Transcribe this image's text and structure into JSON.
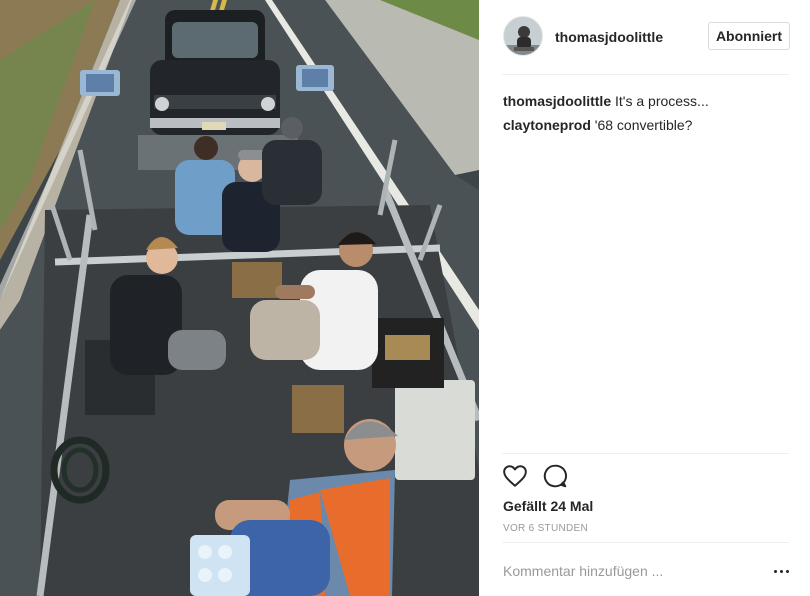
{
  "post": {
    "username": "thomasjdoolittle",
    "follow_label": "Abonniert",
    "photo_alt": "Film crew on a camera car towing a vintage black car"
  },
  "comments": [
    {
      "author": "thomasjdoolittle",
      "text": "It's a process..."
    },
    {
      "author": "claytoneprod",
      "text": "'68 convertible?"
    }
  ],
  "actions": {
    "like_icon": "heart-icon",
    "comment_icon": "comment-bubble-icon"
  },
  "likes_text": "Gefällt 24 Mal",
  "timestamp": "VOR 6 STUNDEN",
  "add_comment_placeholder": "Kommentar hinzufügen ...",
  "more_icon": "ellipsis-icon"
}
